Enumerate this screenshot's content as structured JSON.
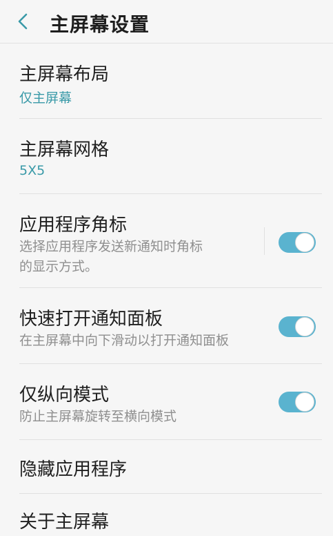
{
  "header": {
    "title": "主屏幕设置",
    "back_icon": "chevron-left-icon"
  },
  "items": [
    {
      "title": "主屏幕布局",
      "subtitle": "仅主屏幕"
    },
    {
      "title": "主屏幕网格",
      "subtitle": "5X5"
    },
    {
      "title": "应用程序角标",
      "subtitle_line1": "选择应用程序发送新通知时角标",
      "subtitle_line2": "的显示方式。",
      "toggle_on": true
    },
    {
      "title": "快速打开通知面板",
      "subtitle": "在主屏幕中向下滑动以打开通知面板",
      "toggle_on": true
    },
    {
      "title": "仅纵向模式",
      "subtitle": "防止主屏幕旋转至横向模式",
      "toggle_on": true
    },
    {
      "title": "隐藏应用程序"
    },
    {
      "title": "关于主屏幕"
    }
  ],
  "colors": {
    "accent": "#3a9aa8",
    "toggle": "#5ab3cf",
    "background": "#f6f6f6"
  }
}
